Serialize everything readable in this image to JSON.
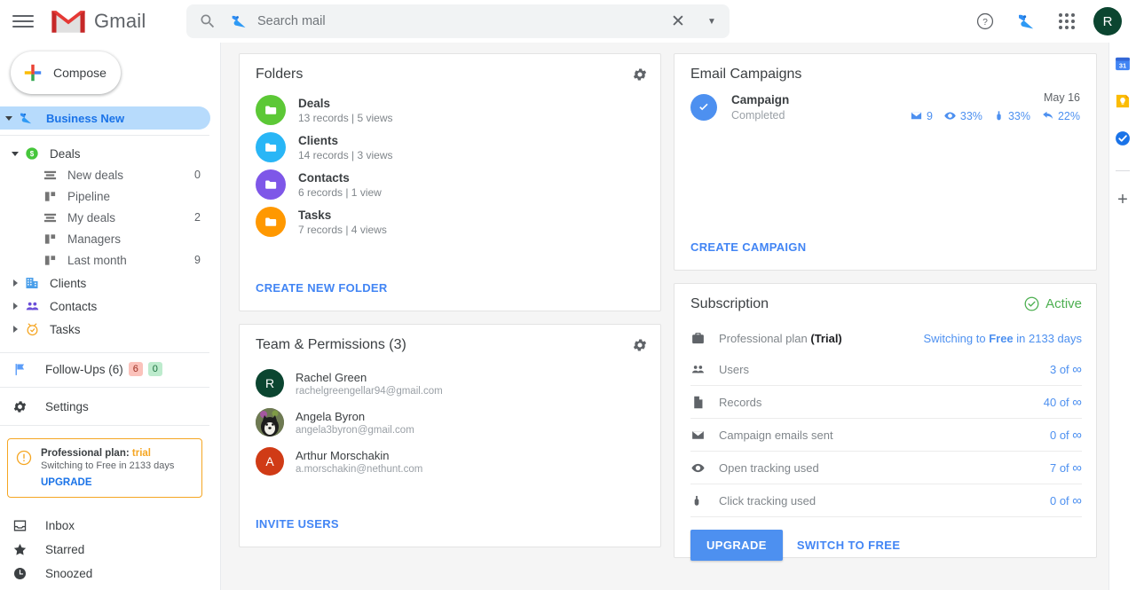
{
  "topbar": {
    "menu_icon": "hamburger-icon",
    "brand": "Gmail",
    "search": {
      "placeholder": "Search mail",
      "value": "",
      "search_icon": "search-icon",
      "crm_icon": "nethunt-bird-icon",
      "clear_icon": "close-icon",
      "options_icon": "chevron-down-icon"
    },
    "help_icon": "help-icon",
    "crm_icon": "nethunt-bird-icon",
    "apps_icon": "apps-grid-icon",
    "avatar_initial": "R"
  },
  "sidebar": {
    "compose_label": "Compose",
    "workspace": {
      "label": "Business New",
      "icon": "nethunt-bird-icon",
      "expanded": true
    },
    "tree": [
      {
        "label": "Deals",
        "icon": "dollar-icon",
        "level": 1,
        "caret": "down",
        "count": ""
      },
      {
        "label": "New deals",
        "icon": "list-view-icon",
        "level": 2,
        "caret": "",
        "count": "0"
      },
      {
        "label": "Pipeline",
        "icon": "board-view-icon",
        "level": 2,
        "caret": "",
        "count": ""
      },
      {
        "label": "My deals",
        "icon": "list-view-icon",
        "level": 2,
        "caret": "",
        "count": "2"
      },
      {
        "label": "Managers",
        "icon": "board-view-icon",
        "level": 2,
        "caret": "",
        "count": ""
      },
      {
        "label": "Last month",
        "icon": "board-view-icon",
        "level": 2,
        "caret": "",
        "count": "9"
      },
      {
        "label": "Clients",
        "icon": "building-icon",
        "level": 1,
        "caret": "right",
        "count": ""
      },
      {
        "label": "Contacts",
        "icon": "people-icon",
        "level": 1,
        "caret": "right",
        "count": ""
      },
      {
        "label": "Tasks",
        "icon": "clock-icon",
        "level": 1,
        "caret": "right",
        "count": ""
      }
    ],
    "followups": {
      "label": "Follow-Ups (6)",
      "icon": "flag-icon",
      "badge_red": "6",
      "badge_green": "0"
    },
    "settings": {
      "label": "Settings",
      "icon": "gear-icon"
    },
    "trial": {
      "title_prefix": "Professional plan: ",
      "title_state": "trial",
      "subtitle": "Switching to Free in 2133 days",
      "action": "UPGRADE",
      "icon": "alert-circle-icon"
    },
    "mail": [
      {
        "label": "Inbox",
        "icon": "inbox-icon"
      },
      {
        "label": "Starred",
        "icon": "star-icon"
      },
      {
        "label": "Snoozed",
        "icon": "clock-icon"
      }
    ]
  },
  "folders_card": {
    "title": "Folders",
    "gear_icon": "gear-icon",
    "items": [
      {
        "name": "Deals",
        "sub": "13 records | 5 views",
        "color": "#5cc836"
      },
      {
        "name": "Clients",
        "sub": "14 records | 3 views",
        "color": "#29b6f6"
      },
      {
        "name": "Contacts",
        "sub": "6 records | 1 view",
        "color": "#7e57e8"
      },
      {
        "name": "Tasks",
        "sub": "7 records | 4 views",
        "color": "#ff9800"
      }
    ],
    "action": "CREATE NEW FOLDER"
  },
  "team_card": {
    "title": "Team & Permissions (3)",
    "gear_icon": "gear-icon",
    "members": [
      {
        "name": "Rachel Green",
        "email": "rachelgreengellar94@gmail.com",
        "initial": "R",
        "color": "#0b4530",
        "photo": false
      },
      {
        "name": "Angela Byron",
        "email": "angela3byron@gmail.com",
        "initial": "",
        "color": "#4a4a42",
        "photo": true
      },
      {
        "name": "Arthur Morschakin",
        "email": "a.morschakin@nethunt.com",
        "initial": "A",
        "color": "#d03b16",
        "photo": false
      }
    ],
    "action": "INVITE USERS"
  },
  "campaigns_card": {
    "title": "Email Campaigns",
    "item": {
      "name": "Campaign",
      "status": "Completed",
      "date": "May 16",
      "status_icon": "check-circle-icon",
      "stats": [
        {
          "icon": "envelope-icon",
          "value": "9"
        },
        {
          "icon": "eye-icon",
          "value": "33%"
        },
        {
          "icon": "click-icon",
          "value": "33%"
        },
        {
          "icon": "reply-icon",
          "value": "22%"
        }
      ]
    },
    "action": "CREATE CAMPAIGN"
  },
  "subscription_card": {
    "title": "Subscription",
    "status": "Active",
    "status_icon": "check-circle-outline-icon",
    "rows": [
      {
        "icon": "briefcase-icon",
        "label": "Professional plan",
        "label_bold": "(Trial)",
        "value_text": "Switching to ",
        "value_bold": "Free",
        "value_suffix": " in 2133 days",
        "type": "plan"
      },
      {
        "icon": "people-icon",
        "label": "Users",
        "value": "3 of",
        "infinity": true,
        "type": "usage"
      },
      {
        "icon": "file-icon",
        "label": "Records",
        "value": "40 of",
        "infinity": true,
        "type": "usage"
      },
      {
        "icon": "envelope-icon",
        "label": "Campaign emails sent",
        "value": "0 of",
        "infinity": true,
        "type": "usage"
      },
      {
        "icon": "eye-icon",
        "label": "Open tracking used",
        "value": "7 of",
        "infinity": true,
        "type": "usage"
      },
      {
        "icon": "click-icon",
        "label": "Click tracking used",
        "value": "0 of",
        "infinity": true,
        "type": "usage"
      }
    ],
    "upgrade_label": "UPGRADE",
    "switch_label": "SWITCH TO FREE"
  },
  "rightrail": {
    "items": [
      {
        "icon": "google-calendar-icon",
        "label": "31"
      },
      {
        "icon": "google-keep-icon",
        "label": ""
      },
      {
        "icon": "google-tasks-icon",
        "label": ""
      }
    ],
    "add_label": "+"
  },
  "colors": {
    "accent_blue": "#4285f4",
    "link_blue": "#4d90f0",
    "active_green": "#4caf50",
    "trial_orange": "#f5a623"
  }
}
